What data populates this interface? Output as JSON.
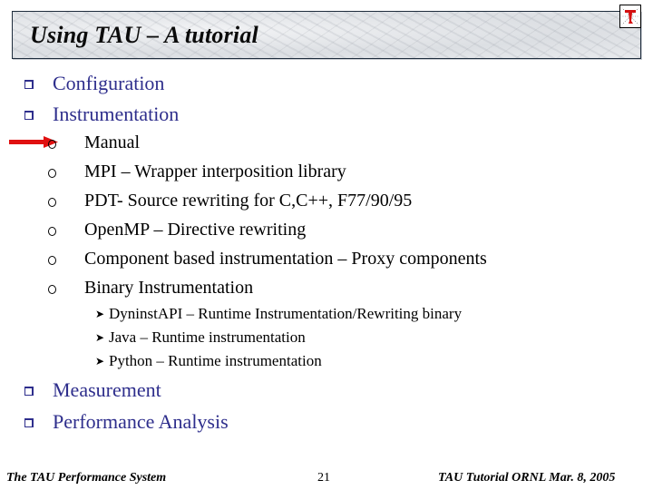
{
  "slide": {
    "title": "Using TAU – A tutorial",
    "logo_icon": "tau-logo-icon",
    "bullets": [
      {
        "label": "Configuration"
      },
      {
        "label": "Instrumentation"
      },
      {
        "label": "Measurement"
      },
      {
        "label": "Performance Analysis"
      }
    ],
    "instrumentation_items": [
      {
        "label": "Manual",
        "highlighted": true
      },
      {
        "label": "MPI – Wrapper interposition library"
      },
      {
        "label": "PDT- Source rewriting for C,C++, F77/90/95"
      },
      {
        "label": "OpenMP – Directive rewriting"
      },
      {
        "label": "Component based instrumentation – Proxy components"
      },
      {
        "label": "Binary Instrumentation"
      }
    ],
    "binary_items": [
      {
        "label": "DyninstAPI – Runtime Instrumentation/Rewriting binary"
      },
      {
        "label": "Java – Runtime instrumentation"
      },
      {
        "label": "Python – Runtime instrumentation"
      }
    ],
    "sub_bullet_glyph": "➤",
    "accent_color": "#2e2e8c",
    "arrow_color": "#e01010"
  },
  "footer": {
    "left": "The TAU Performance System",
    "page_number": "21",
    "right": "TAU Tutorial ORNL Mar. 8, 2005"
  }
}
